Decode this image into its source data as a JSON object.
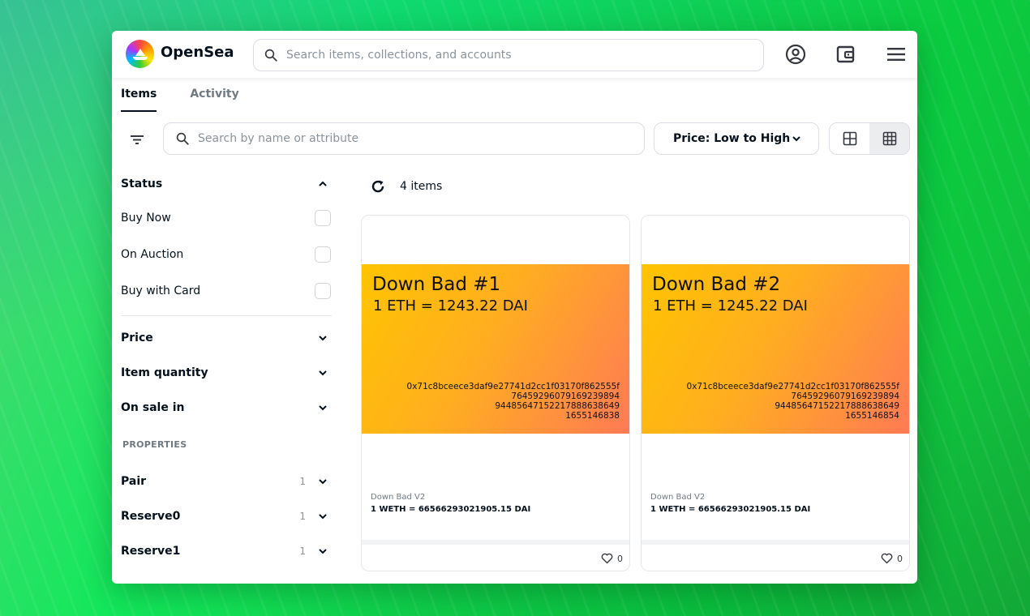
{
  "header": {
    "brand": "OpenSea",
    "search_placeholder": "Search items, collections, and accounts",
    "icons": [
      "account-icon",
      "wallet-icon",
      "menu-icon"
    ]
  },
  "tabs": [
    {
      "label": "Items",
      "active": true
    },
    {
      "label": "Activity",
      "active": false
    }
  ],
  "toolbar": {
    "search_placeholder": "Search by name or attribute",
    "sort_label": "Price: Low to High"
  },
  "sidebar": {
    "status": {
      "label": "Status",
      "options": [
        "Buy Now",
        "On Auction",
        "Buy with Card"
      ]
    },
    "price_label": "Price",
    "quantity_label": "Item quantity",
    "sale_label": "On sale in",
    "properties_label": "PROPERTIES",
    "properties": [
      {
        "label": "Pair",
        "count": "1"
      },
      {
        "label": "Reserve0",
        "count": "1"
      },
      {
        "label": "Reserve1",
        "count": "1"
      }
    ]
  },
  "results": {
    "count_label": "4 items"
  },
  "cards": [
    {
      "title": "Down Bad #1",
      "rate": "1 ETH = 1243.22 DAI",
      "addr": [
        "0x71c8bceece3daf9e27741d2cc1f03170f862555f",
        "76459296079169239894",
        "94485647152217888638649",
        "1655146838"
      ],
      "collection": "Down Bad V2",
      "price": "1 WETH = 66566293021905.15 DAI",
      "favorites": "0"
    },
    {
      "title": "Down Bad #2",
      "rate": "1 ETH = 1245.22 DAI",
      "addr": [
        "0x71c8bceece3daf9e27741d2cc1f03170f862555f",
        "76459296079169239894",
        "94485647152217888638649",
        "1655146854"
      ],
      "collection": "Down Bad V2",
      "price": "1 WETH = 66566293021905.15 DAI",
      "favorites": "0"
    }
  ]
}
